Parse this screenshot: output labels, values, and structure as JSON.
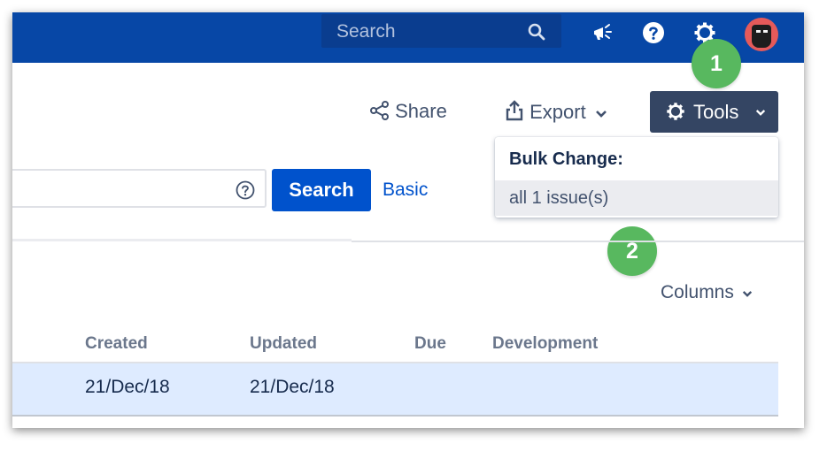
{
  "topbar": {
    "search_placeholder": "Search",
    "icons": [
      "search-icon",
      "megaphone-icon",
      "help-icon",
      "gear-icon",
      "avatar"
    ],
    "background": "#0747a6"
  },
  "actions": {
    "share_label": "Share",
    "export_label": "Export",
    "tools_label": "Tools"
  },
  "tools_menu": {
    "heading": "Bulk Change:",
    "item": "all 1 issue(s)"
  },
  "annotations": {
    "badge1": "1",
    "badge2": "2",
    "color": "#58b85f"
  },
  "query": {
    "search_button": "Search",
    "basic_link": "Basic"
  },
  "results": {
    "columns_label": "Columns",
    "headers": [
      "Created",
      "Updated",
      "Due",
      "Development"
    ],
    "rows": [
      {
        "created": "21/Dec/18",
        "updated": "21/Dec/18",
        "due": "",
        "development": ""
      }
    ]
  }
}
